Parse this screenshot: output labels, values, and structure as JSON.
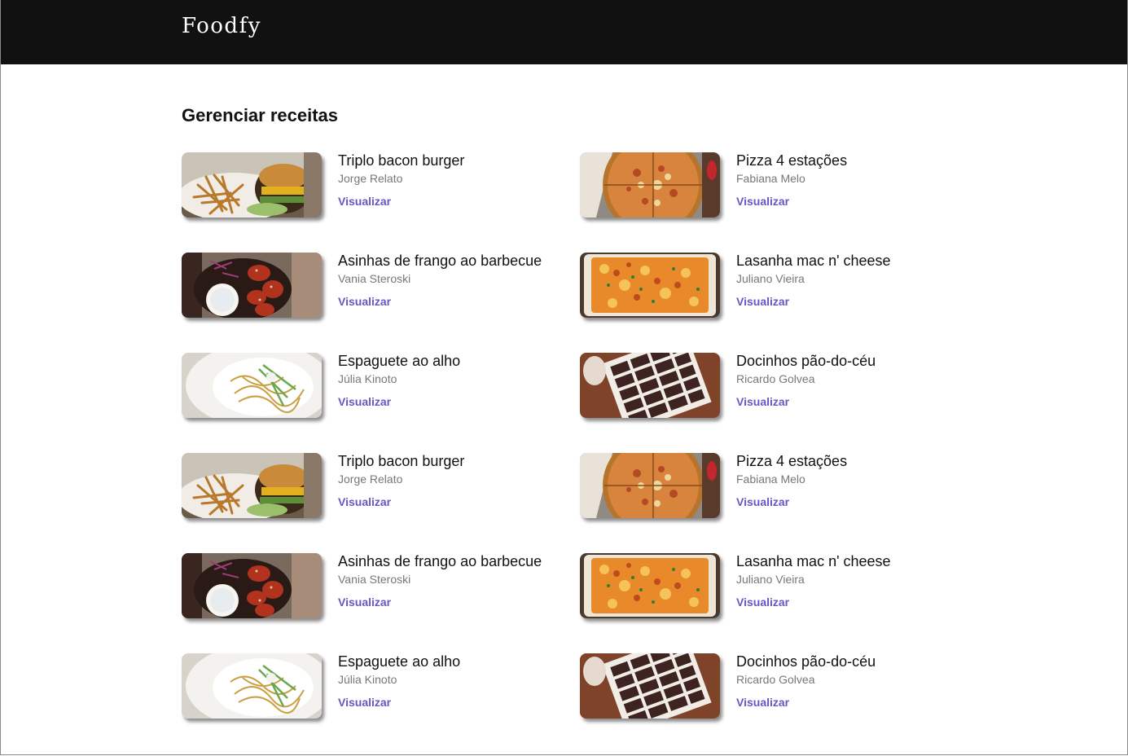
{
  "header": {
    "brand": "Foodfy"
  },
  "main": {
    "title": "Gerenciar receitas",
    "recipes": [
      {
        "title": "Triplo bacon burger",
        "author": "Jorge Relato",
        "action": "Visualizar",
        "image": "burger"
      },
      {
        "title": "Pizza 4 estações",
        "author": "Fabiana Melo",
        "action": "Visualizar",
        "image": "pizza"
      },
      {
        "title": "Asinhas de frango ao barbecue",
        "author": "Vania Steroski",
        "action": "Visualizar",
        "image": "wings"
      },
      {
        "title": "Lasanha mac n' cheese",
        "author": "Juliano Vieira",
        "action": "Visualizar",
        "image": "lasagna"
      },
      {
        "title": "Espaguete ao alho",
        "author": "Júlia Kinoto",
        "action": "Visualizar",
        "image": "spaghetti"
      },
      {
        "title": "Docinhos pão-do-céu",
        "author": "Ricardo Golvea",
        "action": "Visualizar",
        "image": "sweets"
      },
      {
        "title": "Triplo bacon burger",
        "author": "Jorge Relato",
        "action": "Visualizar",
        "image": "burger"
      },
      {
        "title": "Pizza 4 estações",
        "author": "Fabiana Melo",
        "action": "Visualizar",
        "image": "pizza"
      },
      {
        "title": "Asinhas de frango ao barbecue",
        "author": "Vania Steroski",
        "action": "Visualizar",
        "image": "wings"
      },
      {
        "title": "Lasanha mac n' cheese",
        "author": "Juliano Vieira",
        "action": "Visualizar",
        "image": "lasagna"
      },
      {
        "title": "Espaguete ao alho",
        "author": "Júlia Kinoto",
        "action": "Visualizar",
        "image": "spaghetti"
      },
      {
        "title": "Docinhos pão-do-céu",
        "author": "Ricardo Golvea",
        "action": "Visualizar",
        "image": "sweets"
      }
    ]
  },
  "colors": {
    "header_bg": "#111111",
    "link": "#6558c3",
    "author_text": "#777777"
  }
}
